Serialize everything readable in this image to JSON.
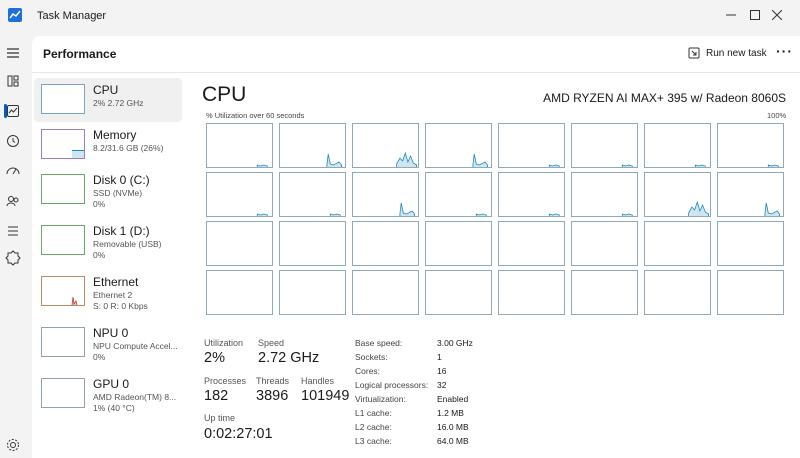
{
  "window": {
    "title": "Task Manager"
  },
  "header": {
    "page_title": "Performance",
    "run_new_task": "Run new task"
  },
  "devices": [
    {
      "name": "CPU",
      "line1": "2%  2.72 GHz",
      "line2": ""
    },
    {
      "name": "Memory",
      "line1": "8.2/31.6 GB (26%)",
      "line2": ""
    },
    {
      "name": "Disk 0 (C:)",
      "line1": "SSD (NVMe)",
      "line2": "0%"
    },
    {
      "name": "Disk 1 (D:)",
      "line1": "Removable (USB)",
      "line2": "0%"
    },
    {
      "name": "Ethernet",
      "line1": "Ethernet 2",
      "line2": "S: 0 R: 0 Kbps"
    },
    {
      "name": "NPU 0",
      "line1": "NPU Compute Accel...",
      "line2": "0%"
    },
    {
      "name": "GPU 0",
      "line1": "AMD Radeon(TM) 8...",
      "line2": "1%  (40 °C)"
    }
  ],
  "main": {
    "title": "CPU",
    "model": "AMD RYZEN AI MAX+ 395 w/ Radeon 8060S",
    "graph_caption": "% Utilization over 60 seconds",
    "graph_max": "100%",
    "colors": {
      "line": "#1b8bbd",
      "fill": "#cfe6f2",
      "border": "#8fa9b8"
    }
  },
  "stats": {
    "utilization_label": "Utilization",
    "utilization": "2%",
    "speed_label": "Speed",
    "speed": "2.72 GHz",
    "processes_label": "Processes",
    "processes": "182",
    "threads_label": "Threads",
    "threads": "3896",
    "handles_label": "Handles",
    "handles": "101949",
    "uptime_label": "Up time",
    "uptime": "0:02:27:01"
  },
  "specs": [
    {
      "label": "Base speed:",
      "value": "3.00 GHz"
    },
    {
      "label": "Sockets:",
      "value": "1"
    },
    {
      "label": "Cores:",
      "value": "16"
    },
    {
      "label": "Logical processors:",
      "value": "32"
    },
    {
      "label": "Virtualization:",
      "value": "Enabled"
    },
    {
      "label": "L1 cache:",
      "value": "1.2 MB"
    },
    {
      "label": "L2 cache:",
      "value": "16.0 MB"
    },
    {
      "label": "L3 cache:",
      "value": "64.0 MB"
    }
  ],
  "core_activity": [
    "low",
    "spike",
    "burst",
    "spike",
    "low",
    "low",
    "low",
    "low",
    "low",
    "low",
    "spike",
    "low",
    "low",
    "low",
    "burst",
    "spike",
    "idle",
    "idle",
    "idle",
    "idle",
    "idle",
    "idle",
    "idle",
    "idle",
    "idle",
    "idle",
    "idle",
    "idle",
    "idle",
    "idle",
    "idle",
    "idle"
  ],
  "icons": [
    "hamburger-icon",
    "processes-icon",
    "performance-icon",
    "app-history-icon",
    "startup-icon",
    "users-icon",
    "services-icon",
    "settings-icon"
  ]
}
